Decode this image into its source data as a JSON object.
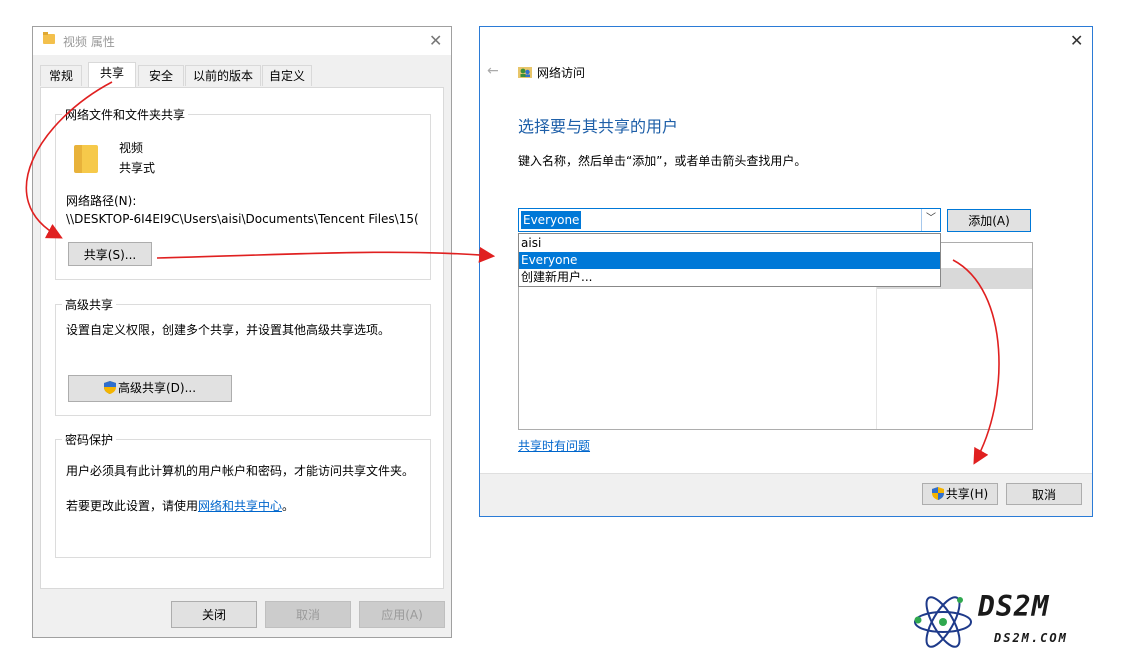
{
  "properties_dialog": {
    "title": "视频 属性",
    "tabs": [
      "常规",
      "共享",
      "安全",
      "以前的版本",
      "自定义"
    ],
    "network_sharing": {
      "group_title": "网络文件和文件夹共享",
      "folder_name": "视频",
      "folder_status": "共享式",
      "path_label": "网络路径(N):",
      "path_value": "\\\\DESKTOP-6I4EI9C\\Users\\aisi\\Documents\\Tencent Files\\15(",
      "share_button": "共享(S)..."
    },
    "advanced_sharing": {
      "group_title": "高级共享",
      "description": "设置自定义权限，创建多个共享，并设置其他高级共享选项。",
      "button": "高级共享(D)..."
    },
    "password_protection": {
      "group_title": "密码保护",
      "line1": "用户必须具有此计算机的用户帐户和密码，才能访问共享文件夹。",
      "line2_prefix": "若要更改此设置，请使用",
      "line2_link": "网络和共享中心",
      "line2_suffix": "。"
    },
    "footer": {
      "close": "关闭",
      "cancel": "取消",
      "apply": "应用(A)"
    }
  },
  "network_access_dialog": {
    "title": "网络访问",
    "heading": "选择要与其共享的用户",
    "instruction": "键入名称，然后单击“添加”，或者单击箭头查找用户。",
    "combo_value": "Everyone",
    "add_button": "添加(A)",
    "dropdown_options": [
      "aisi",
      "Everyone",
      "创建新用户..."
    ],
    "dropdown_selected": "Everyone",
    "help_link": "共享时有问题",
    "share_button": "共享(H)",
    "cancel_button": "取消"
  },
  "watermark": {
    "brand": "DS2M",
    "domain": "DS2M.COM"
  },
  "colors": {
    "accent": "#0078d7",
    "arrow": "#e02020",
    "link": "#0066cc",
    "heading": "#1e5fa8"
  }
}
